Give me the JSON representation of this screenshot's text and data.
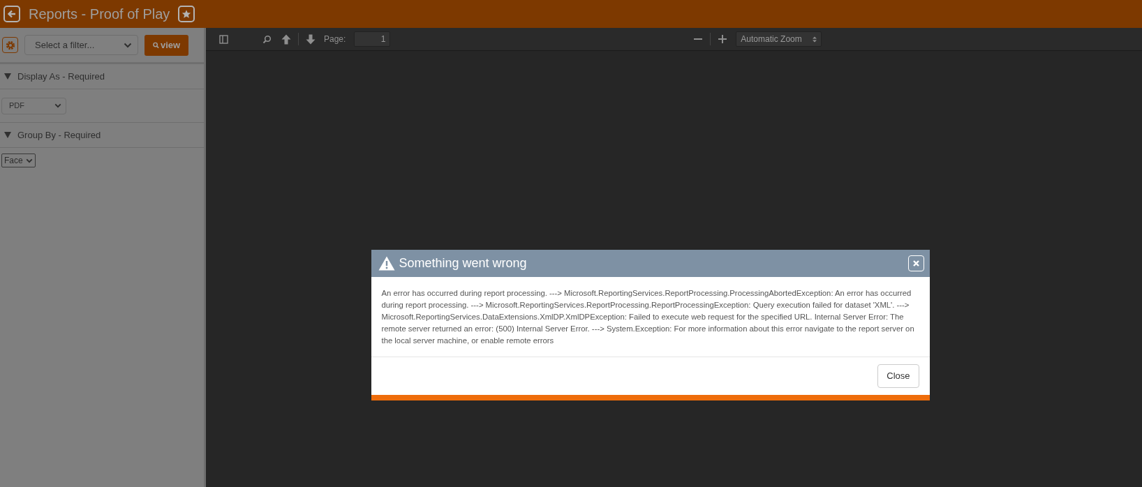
{
  "header": {
    "title": "Reports - Proof of Play"
  },
  "sidebar": {
    "filter": {
      "placeholder": "Select a filter..."
    },
    "view_button": "view",
    "sections": [
      {
        "title": "Display As - Required",
        "expanded": true,
        "value": "PDF",
        "kind": "wide"
      },
      {
        "title": "Group By - Required",
        "expanded": true,
        "value": "Face",
        "kind": "small"
      }
    ]
  },
  "viewer_toolbar": {
    "page_label": "Page:",
    "page_value": "1",
    "zoom": "Automatic Zoom"
  },
  "dialog": {
    "title": "Something went wrong",
    "message": "An error has occurred during report processing. ---> Microsoft.ReportingServices.ReportProcessing.ProcessingAbortedException: An error has occurred during report processing. ---> Microsoft.ReportingServices.ReportProcessing.ReportProcessingException: Query execution failed for dataset 'XML'. ---> Microsoft.ReportingServices.DataExtensions.XmlDP.XmlDPException: Failed to execute web request for the specified URL. Internal Server Error: The remote server returned an error: (500) Internal Server Error. ---> System.Exception: For more information about this error navigate to the report server on the local server machine, or enable remote errors",
    "close_button": "Close"
  }
}
